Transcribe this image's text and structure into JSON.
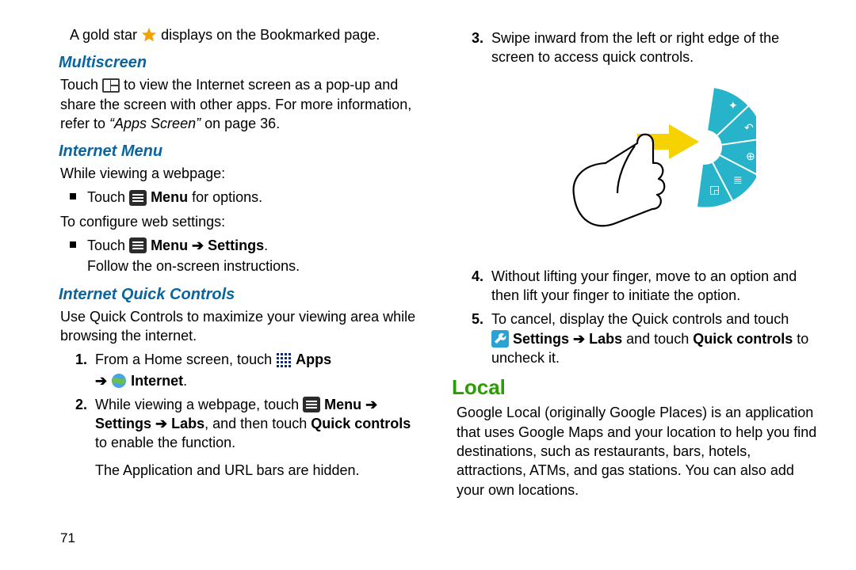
{
  "left": {
    "goldstar_pre": "A gold star ",
    "goldstar_post": " displays on the Bookmarked page.",
    "h_multiscreen": "Multiscreen",
    "multi_pre": "Touch ",
    "multi_post": " to view the Internet screen as a pop-up and share the screen with other apps. For more information, refer to ",
    "multi_ital": "“Apps Screen”",
    "multi_tail": " on page 36.",
    "h_menu": "Internet Menu",
    "menu_intro": "While viewing a webpage:",
    "menu_b1_pre": "Touch ",
    "menu_b1_bold": " Menu",
    "menu_b1_post": " for options.",
    "menu_cfg": "To configure web settings:",
    "menu_b2_pre": "Touch ",
    "menu_b2_bold": " Menu ➔ Settings",
    "menu_b2_post": ".",
    "menu_b2_sub": "Follow the on-screen instructions.",
    "h_qc": "Internet Quick Controls",
    "qc_intro": "Use Quick Controls to maximize your viewing area while browsing the internet.",
    "qc1_num": "1.",
    "qc1_pre": "From a Home screen, touch ",
    "qc1_apps": " Apps",
    "qc1_arrow": "➔ ",
    "qc1_internet": " Internet",
    "qc1_dot": ".",
    "qc2_num": "2.",
    "qc2_pre": "While viewing a webpage, touch ",
    "qc2_menu": " Menu ➔ Settings",
    "qc2_mid": "➔ Labs",
    "qc2_mid2": ", and then touch ",
    "qc2_qc": "Quick controls",
    "qc2_post": " to enable the function.",
    "qc2_sub": "The Application and URL bars are hidden.",
    "pagenum": "71"
  },
  "right": {
    "r3_num": "3.",
    "r3_txt": "Swipe inward from the left or right edge of the screen to access quick controls.",
    "r4_num": "4.",
    "r4_txt": "Without lifting your finger, move to an option and then lift your finger to initiate the option.",
    "r5_num": "5.",
    "r5_pre": "To cancel, display the Quick controls and touch ",
    "r5_settings": " Settings ➔ Labs",
    "r5_mid": " and touch ",
    "r5_qc": "Quick controls",
    "r5_post": " to uncheck it.",
    "h_local": "Local",
    "local_txt": "Google Local (originally Google Places) is an application that uses Google Maps and your location to help you find destinations, such as restaurants, bars, hotels, attractions, ATMs, and gas stations. You can also add your own locations."
  }
}
